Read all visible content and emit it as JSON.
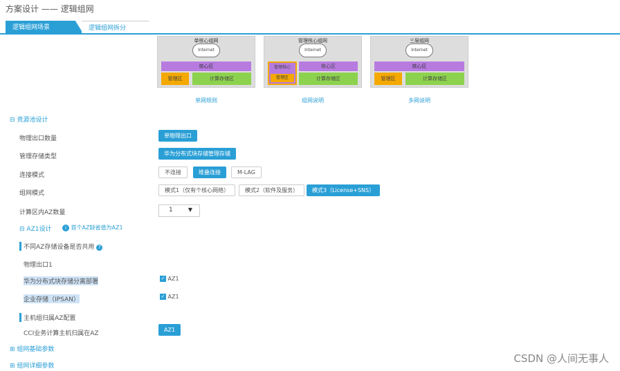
{
  "header": {
    "title": "方案设计 —— 逻辑组网"
  },
  "tabs": [
    {
      "label": "逻辑组网场景"
    },
    {
      "label": "逻辑组网拆分"
    }
  ],
  "topologies": [
    {
      "title": "单核心组网",
      "cloud": "Internet",
      "core": "核心区",
      "mgmt": "管理区",
      "compute": "计算存储区",
      "link": "单网规则"
    },
    {
      "title": "管理核心组网",
      "cloud": "Internet",
      "mgmt_core": "管理核心",
      "mgmt": "管理区",
      "core": "核心区",
      "compute": "计算存储区",
      "link": "组网说明"
    },
    {
      "title": "三层组网",
      "cloud": "Internet",
      "core": "核心区",
      "mgmt": "管理区",
      "compute": "计算存储区",
      "link": "多网说明"
    }
  ],
  "form": {
    "resource_section": "资源池设计",
    "rows": [
      {
        "label": "物理出口数量",
        "value": "单物理出口"
      },
      {
        "label": "管理存储类型",
        "value": "华为分布式块存储管理存储"
      },
      {
        "label": "连接模式",
        "options": [
          "不连接",
          "堆叠连接",
          "M-LAG"
        ],
        "selected": "堆叠连接"
      },
      {
        "label": "组网模式",
        "options": [
          "模式1（仅有个核心网络）",
          "模式2（软件及服务）",
          "模式3（License+SNS）"
        ],
        "selected": "模式3（License+SNS）"
      },
      {
        "label": "计算区内AZ数量",
        "value": "1"
      }
    ],
    "az_section": "AZ1设计",
    "az_info": "首个AZ缺省值为AZ1",
    "storage_share_label": "不同AZ存储设备是否共用",
    "port_label": "物理出口1",
    "dist_storage_label": "华为分布式块存储分离部署",
    "dist_storage_az": "AZ1",
    "enterprise_storage_label": "企业存储（IPSAN）",
    "enterprise_storage_az": "AZ1",
    "host_group_label": "主机组归属AZ配置",
    "host_group_row_label": "CCI业务计算主机归属在AZ",
    "host_group_value": "AZ1",
    "networking_params": "组网基础参数",
    "networking_detail": "组网详细参数"
  },
  "watermark": "CSDN @人间无事人"
}
